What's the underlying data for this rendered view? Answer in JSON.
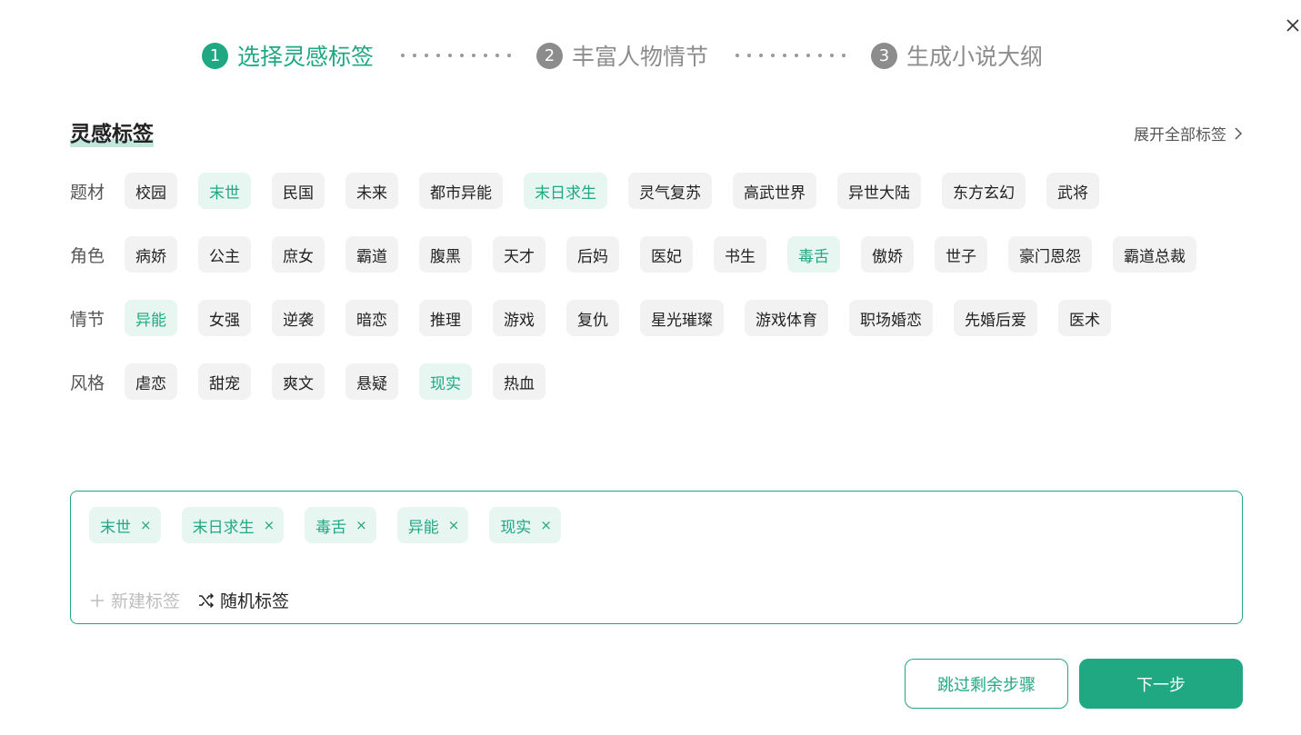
{
  "steps": [
    {
      "num": "1",
      "label": "选择灵感标签"
    },
    {
      "num": "2",
      "label": "丰富人物情节"
    },
    {
      "num": "3",
      "label": "生成小说大纲"
    }
  ],
  "section_title": "灵感标签",
  "expand_link": "展开全部标签",
  "rows": [
    {
      "label": "题材",
      "tags": [
        "校园",
        "末世",
        "民国",
        "未来",
        "都市异能",
        "末日求生",
        "灵气复苏",
        "高武世界",
        "异世大陆",
        "东方玄幻",
        "武将"
      ],
      "selected": [
        1,
        5
      ]
    },
    {
      "label": "角色",
      "tags": [
        "病娇",
        "公主",
        "庶女",
        "霸道",
        "腹黑",
        "天才",
        "后妈",
        "医妃",
        "书生",
        "毒舌",
        "傲娇",
        "世子",
        "豪门恩怨",
        "霸道总裁"
      ],
      "selected": [
        9
      ]
    },
    {
      "label": "情节",
      "tags": [
        "异能",
        "女强",
        "逆袭",
        "暗恋",
        "推理",
        "游戏",
        "复仇",
        "星光璀璨",
        "游戏体育",
        "职场婚恋",
        "先婚后爱",
        "医术"
      ],
      "selected": [
        0
      ]
    },
    {
      "label": "风格",
      "tags": [
        "虐恋",
        "甜宠",
        "爽文",
        "悬疑",
        "现实",
        "热血"
      ],
      "selected": [
        4
      ]
    }
  ],
  "selected_tags": [
    "末世",
    "末日求生",
    "毒舌",
    "异能",
    "现实"
  ],
  "chip_remove_symbol": "×",
  "new_tag_label": "新建标签",
  "random_tag_label": "随机标签",
  "skip_button": "跳过剩余步骤",
  "next_button": "下一步",
  "colors": {
    "accent": "#20a882",
    "accent_light": "#e8f6f1",
    "tag_bg": "#f2f2f2"
  }
}
